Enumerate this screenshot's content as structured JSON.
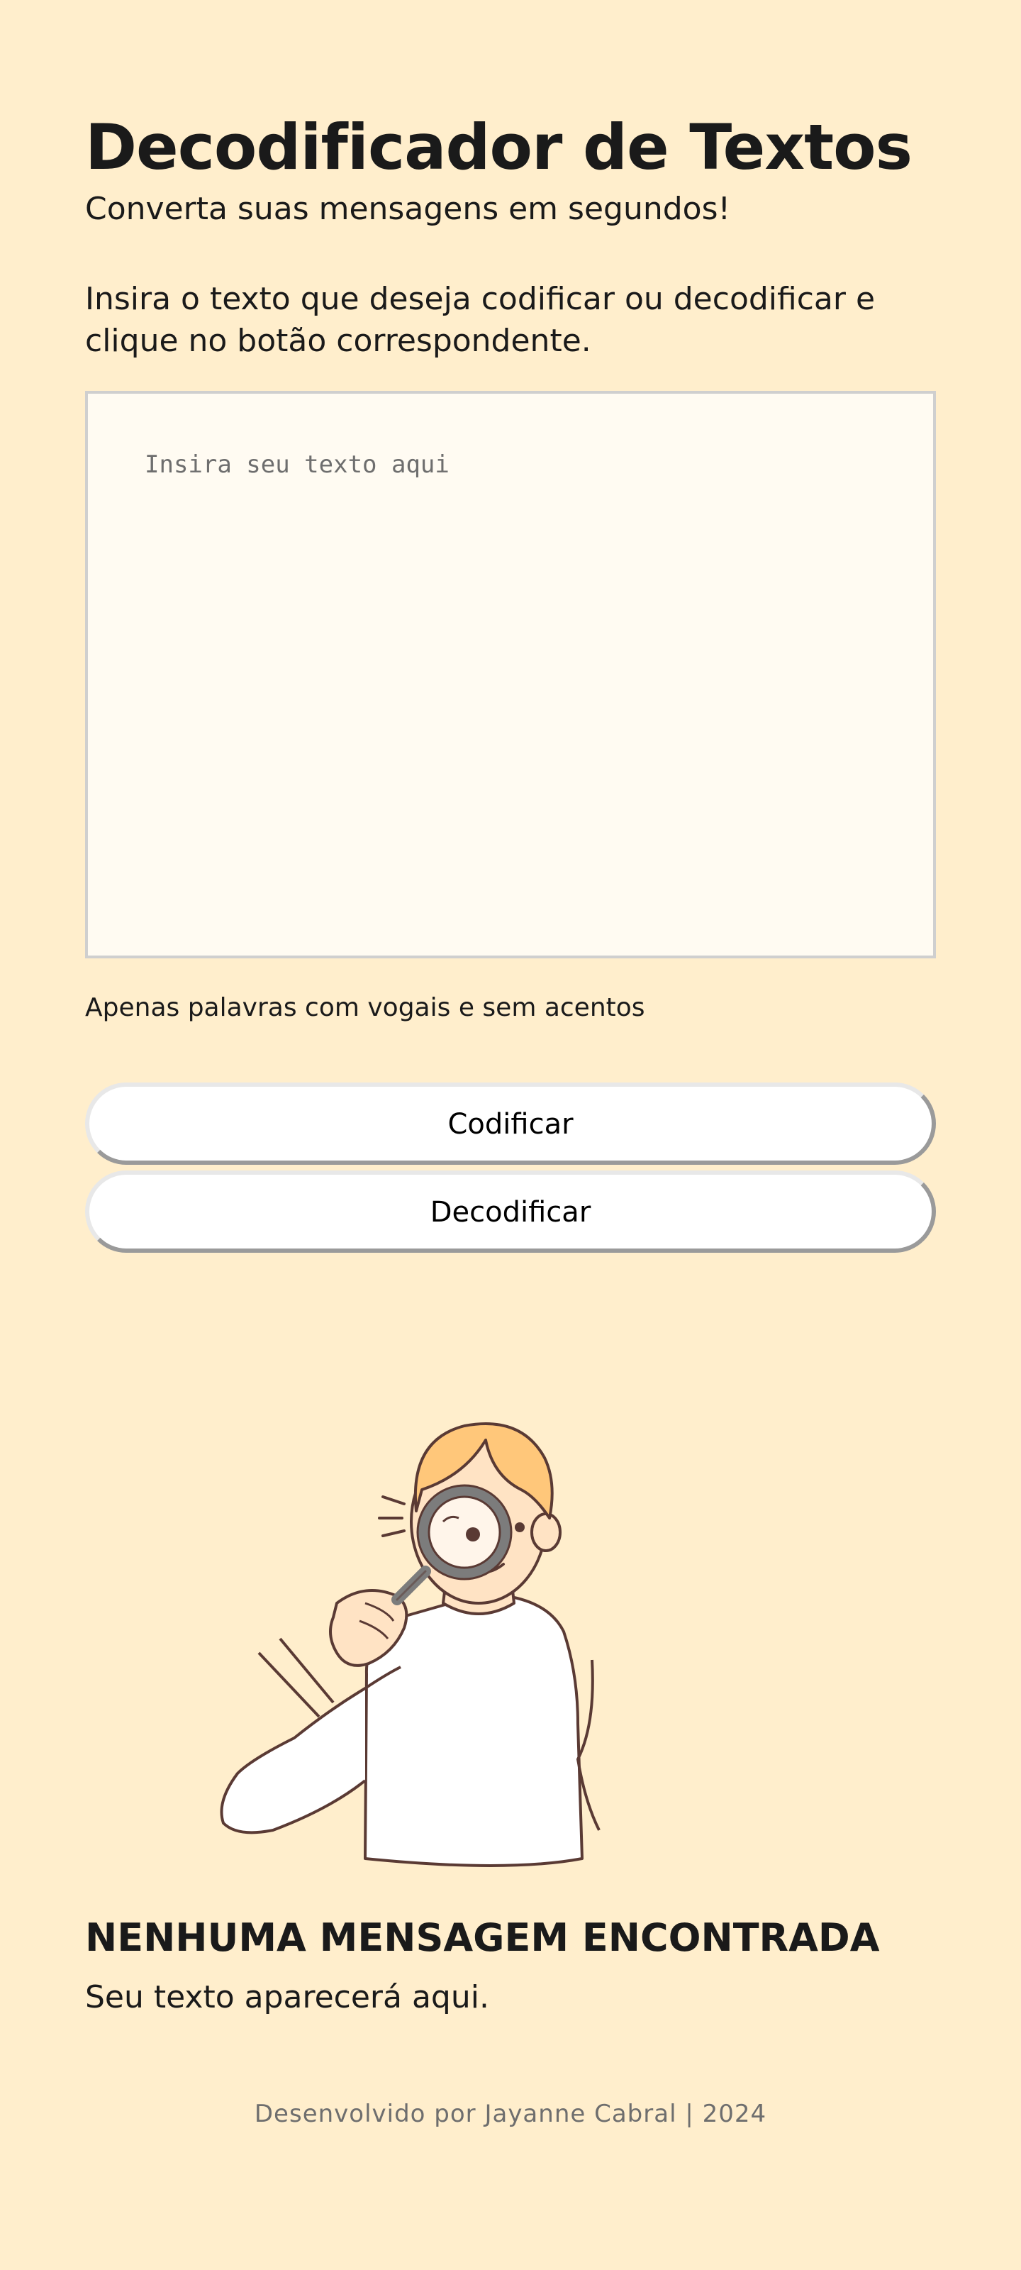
{
  "header": {
    "title": "Decodificador de Textos",
    "subtitle": "Converta suas mensagens em segundos!"
  },
  "main": {
    "instructions": "Insira o texto que deseja codificar ou decodificar e clique no botão correspondente.",
    "input": {
      "placeholder": "Insira seu texto aqui",
      "value": ""
    },
    "hint": "Apenas palavras com vogais e sem acentos",
    "buttons": {
      "encode_label": "Codificar",
      "decode_label": "Decodificar"
    }
  },
  "output": {
    "illustration": "person-with-magnifying-glass",
    "empty_title": "NENHUMA MENSAGEM ENCONTRADA",
    "empty_subtitle": "Seu texto aparecerá aqui."
  },
  "footer": {
    "text": "Desenvolvido por Jayanne Cabral | 2024"
  },
  "colors": {
    "background": "#FFEECC",
    "textarea_background": "#FFFBF2",
    "button_background": "#FFFFFF",
    "hair": "#FFC77A",
    "skin": "#FFE3C4",
    "outline": "#5A3A34"
  }
}
